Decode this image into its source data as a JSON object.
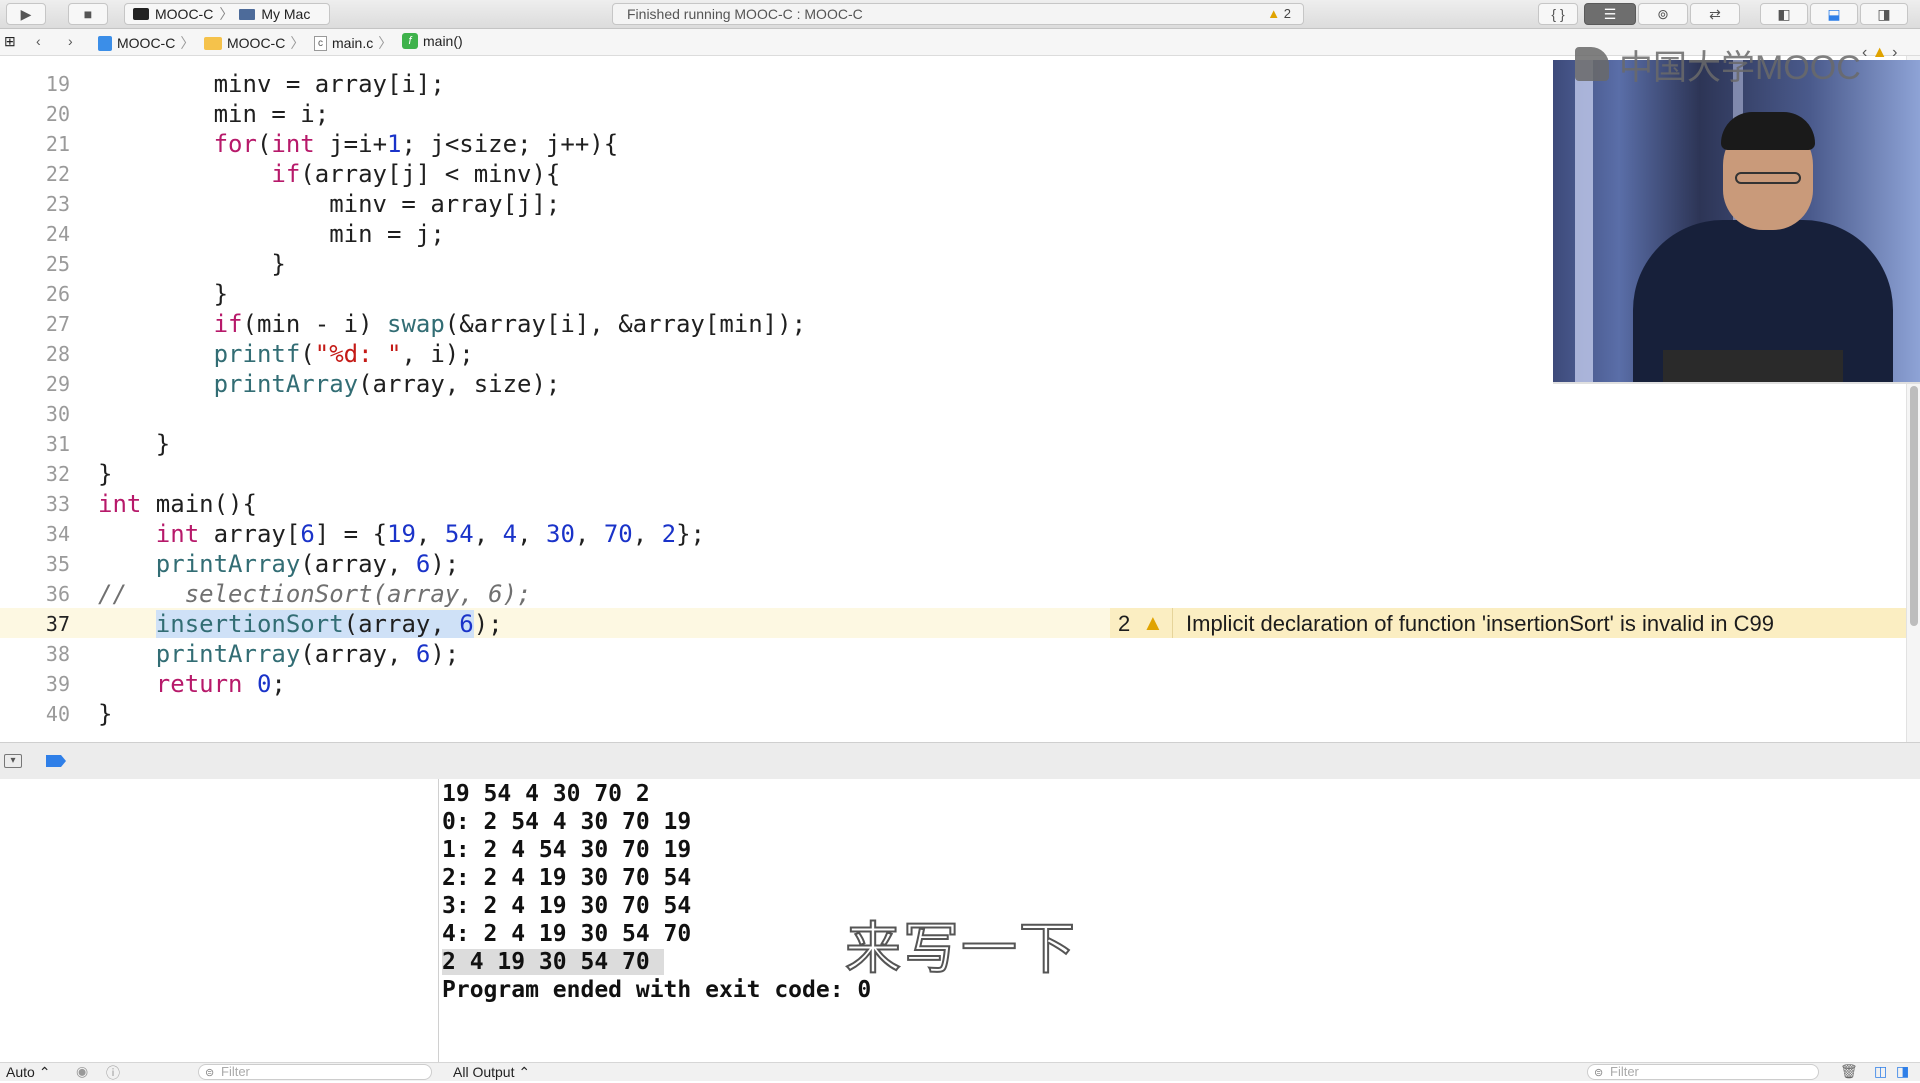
{
  "toolbar": {
    "run_icon": "play-icon",
    "stop_icon": "stop-icon",
    "scheme": "MOOC-C",
    "destination": "My Mac",
    "activity": "Finished running MOOC-C : MOOC-C",
    "warning_count": "2"
  },
  "jumpbar": {
    "crumbs": [
      "MOOC-C",
      "MOOC-C",
      "main.c",
      "main()"
    ]
  },
  "editor": {
    "lines": [
      {
        "n": "19",
        "code": "        minv = array[i];"
      },
      {
        "n": "20",
        "code": "        min = i;"
      },
      {
        "n": "21",
        "code": "        for(int j=i+1; j<size; j++){"
      },
      {
        "n": "22",
        "code": "            if(array[j] < minv){"
      },
      {
        "n": "23",
        "code": "                minv = array[j];"
      },
      {
        "n": "24",
        "code": "                min = j;"
      },
      {
        "n": "25",
        "code": "            }"
      },
      {
        "n": "26",
        "code": "        }"
      },
      {
        "n": "27",
        "code": "        if(min - i) swap(&array[i], &array[min]);"
      },
      {
        "n": "28",
        "code": "        printf(\"%d: \", i);"
      },
      {
        "n": "29",
        "code": "        printArray(array, size);"
      },
      {
        "n": "30",
        "code": ""
      },
      {
        "n": "31",
        "code": "    }"
      },
      {
        "n": "32",
        "code": "}"
      },
      {
        "n": "33",
        "code": "int main(){"
      },
      {
        "n": "34",
        "code": "    int array[6] = {19, 54, 4, 30, 70, 2};"
      },
      {
        "n": "35",
        "code": "    printArray(array, 6);"
      },
      {
        "n": "36",
        "code": "//    selectionSort(array, 6);"
      },
      {
        "n": "37",
        "code": "    insertionSort(array, 6);"
      },
      {
        "n": "38",
        "code": "    printArray(array, 6);"
      },
      {
        "n": "39",
        "code": "    return 0;"
      },
      {
        "n": "40",
        "code": "}"
      }
    ],
    "current_line": "37",
    "issue": {
      "count": "2",
      "message": "Implicit declaration of function 'insertionSort' is invalid in C99"
    }
  },
  "overlay": {
    "logo_text": "中国大学MOOC",
    "subtitle": "来写一下"
  },
  "console": {
    "lines": [
      "19 54 4 30 70 2",
      "0: 2 54 4 30 70 19",
      "1: 2 4 54 30 70 19",
      "2: 2 4 19 30 70 54",
      "3: 2 4 19 30 70 54",
      "4: 2 4 19 30 54 70",
      "2 4 19 30 54 70",
      "Program ended with exit code: 0"
    ],
    "highlighted_index": 6
  },
  "statusbar": {
    "auto_label": "Auto ⌃",
    "filter_placeholder": "Filter",
    "output_label": "All Output ⌃",
    "console_filter_placeholder": "Filter"
  },
  "colors": {
    "keyword": "#b7196a",
    "number": "#1a33c9",
    "string": "#c41a16",
    "function": "#326d74",
    "warning": "#e0a300",
    "current_line_bg": "#fdf8e2",
    "warning_bar_bg": "#fbeec2"
  }
}
